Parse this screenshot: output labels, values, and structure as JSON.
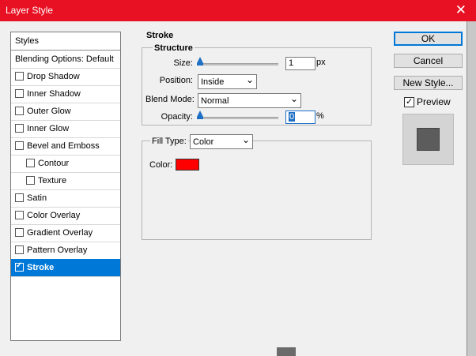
{
  "window": {
    "title": "Layer Style",
    "close_glyph": "✕"
  },
  "styles_panel": {
    "header": "Styles",
    "items": [
      {
        "label": "Blending Options: Default",
        "checkbox": false,
        "checked": false,
        "indent": false,
        "selected": false
      },
      {
        "label": "Drop Shadow",
        "checkbox": true,
        "checked": false,
        "indent": false,
        "selected": false
      },
      {
        "label": "Inner Shadow",
        "checkbox": true,
        "checked": false,
        "indent": false,
        "selected": false
      },
      {
        "label": "Outer Glow",
        "checkbox": true,
        "checked": false,
        "indent": false,
        "selected": false
      },
      {
        "label": "Inner Glow",
        "checkbox": true,
        "checked": false,
        "indent": false,
        "selected": false
      },
      {
        "label": "Bevel and Emboss",
        "checkbox": true,
        "checked": false,
        "indent": false,
        "selected": false
      },
      {
        "label": "Contour",
        "checkbox": true,
        "checked": false,
        "indent": true,
        "selected": false
      },
      {
        "label": "Texture",
        "checkbox": true,
        "checked": false,
        "indent": true,
        "selected": false
      },
      {
        "label": "Satin",
        "checkbox": true,
        "checked": false,
        "indent": false,
        "selected": false
      },
      {
        "label": "Color Overlay",
        "checkbox": true,
        "checked": false,
        "indent": false,
        "selected": false
      },
      {
        "label": "Gradient Overlay",
        "checkbox": true,
        "checked": false,
        "indent": false,
        "selected": false
      },
      {
        "label": "Pattern Overlay",
        "checkbox": true,
        "checked": false,
        "indent": false,
        "selected": false
      },
      {
        "label": "Stroke",
        "checkbox": true,
        "checked": true,
        "indent": false,
        "selected": true
      }
    ]
  },
  "stroke": {
    "section_title": "Stroke",
    "structure_title": "Structure",
    "size_label": "Size:",
    "size_value": "1",
    "size_unit": "px",
    "size_slider_fraction": 0,
    "position_label": "Position:",
    "position_value": "Inside",
    "blend_mode_label": "Blend Mode:",
    "blend_mode_value": "Normal",
    "opacity_label": "Opacity:",
    "opacity_value": "0",
    "opacity_unit": "%",
    "opacity_slider_fraction": 0,
    "fill_type_label": "Fill Type:",
    "fill_type_value": "Color",
    "color_label": "Color:",
    "color_value": "#ff0000"
  },
  "buttons": {
    "ok": "OK",
    "cancel": "Cancel",
    "new_style": "New Style..."
  },
  "preview": {
    "label": "Preview",
    "checked": true
  },
  "colors": {
    "title_bar": "#e81123",
    "selection": "#0078d7",
    "stroke_color": "#ff0000"
  }
}
